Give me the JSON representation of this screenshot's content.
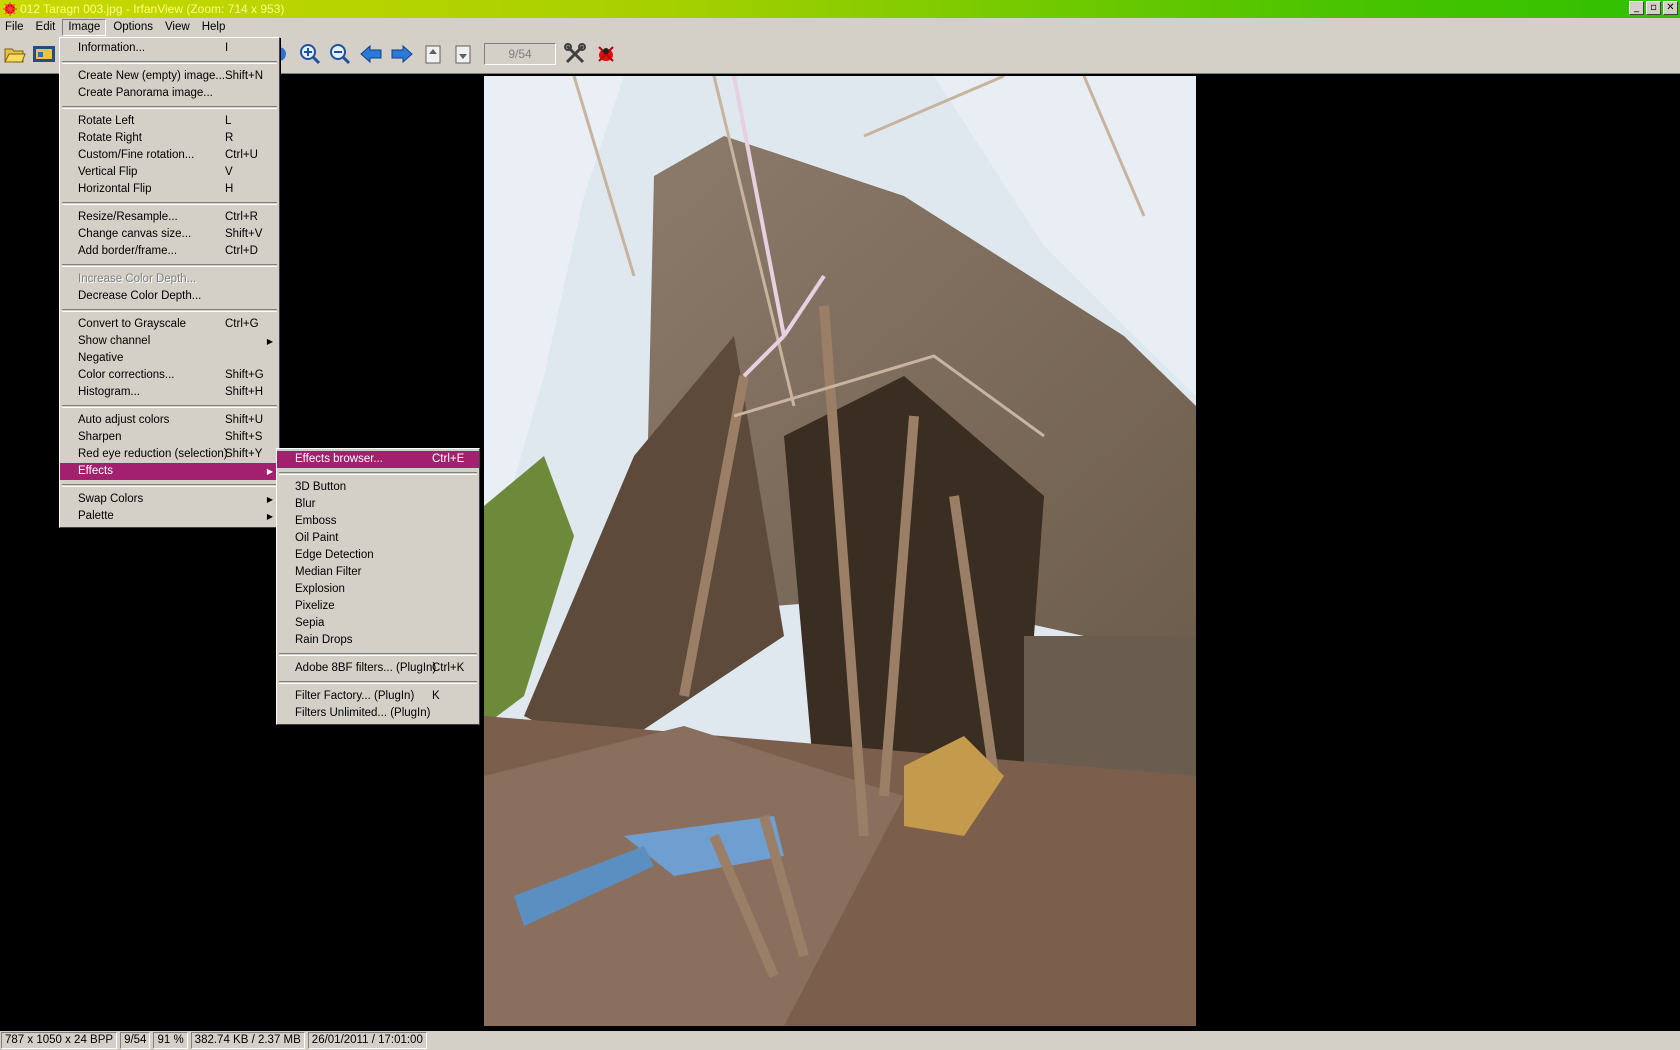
{
  "window": {
    "title": "012 Taragn 003.jpg - IrfanView (Zoom: 714 x 953)",
    "buttons": {
      "minimize": "_",
      "maximize": "▫",
      "close": "✕"
    }
  },
  "menubar": [
    {
      "label": "File"
    },
    {
      "label": "Edit"
    },
    {
      "label": "Image"
    },
    {
      "label": "Options"
    },
    {
      "label": "View"
    },
    {
      "label": "Help"
    }
  ],
  "toolbar": {
    "page_counter": "9/54"
  },
  "image_menu": {
    "groups": [
      [
        {
          "label": "Information...",
          "shortcut": "I"
        }
      ],
      [
        {
          "label": "Create New (empty) image...",
          "shortcut": "Shift+N"
        },
        {
          "label": "Create Panorama image...",
          "shortcut": ""
        }
      ],
      [
        {
          "label": "Rotate Left",
          "shortcut": "L"
        },
        {
          "label": "Rotate Right",
          "shortcut": "R"
        },
        {
          "label": "Custom/Fine rotation...",
          "shortcut": "Ctrl+U"
        },
        {
          "label": "Vertical Flip",
          "shortcut": "V"
        },
        {
          "label": "Horizontal Flip",
          "shortcut": "H"
        }
      ],
      [
        {
          "label": "Resize/Resample...",
          "shortcut": "Ctrl+R"
        },
        {
          "label": "Change canvas size...",
          "shortcut": "Shift+V"
        },
        {
          "label": "Add border/frame...",
          "shortcut": "Ctrl+D"
        }
      ],
      [
        {
          "label": "Increase Color Depth...",
          "shortcut": "",
          "disabled": true
        },
        {
          "label": "Decrease Color Depth...",
          "shortcut": ""
        }
      ],
      [
        {
          "label": "Convert to Grayscale",
          "shortcut": "Ctrl+G"
        },
        {
          "label": "Show channel",
          "shortcut": "",
          "submenu": true
        },
        {
          "label": "Negative",
          "shortcut": ""
        },
        {
          "label": "Color corrections...",
          "shortcut": "Shift+G"
        },
        {
          "label": "Histogram...",
          "shortcut": "Shift+H"
        }
      ],
      [
        {
          "label": "Auto adjust colors",
          "shortcut": "Shift+U"
        },
        {
          "label": "Sharpen",
          "shortcut": "Shift+S"
        },
        {
          "label": "Red eye reduction (selection)",
          "shortcut": "Shift+Y"
        },
        {
          "label": "Effects",
          "shortcut": "",
          "submenu": true,
          "selected": true
        }
      ],
      [
        {
          "label": "Swap Colors",
          "shortcut": "",
          "submenu": true
        },
        {
          "label": "Palette",
          "shortcut": "",
          "submenu": true
        }
      ]
    ]
  },
  "effects_submenu": {
    "groups": [
      [
        {
          "label": "Effects browser...",
          "shortcut": "Ctrl+E",
          "selected": true
        }
      ],
      [
        {
          "label": "3D Button",
          "shortcut": ""
        },
        {
          "label": "Blur",
          "shortcut": ""
        },
        {
          "label": "Emboss",
          "shortcut": ""
        },
        {
          "label": "Oil Paint",
          "shortcut": ""
        },
        {
          "label": "Edge Detection",
          "shortcut": ""
        },
        {
          "label": "Median Filter",
          "shortcut": ""
        },
        {
          "label": "Explosion",
          "shortcut": ""
        },
        {
          "label": "Pixelize",
          "shortcut": ""
        },
        {
          "label": "Sepia",
          "shortcut": ""
        },
        {
          "label": "Rain Drops",
          "shortcut": ""
        }
      ],
      [
        {
          "label": "Adobe 8BF filters... (PlugIn)",
          "shortcut": "Ctrl+K"
        }
      ],
      [
        {
          "label": "Filter Factory... (PlugIn)",
          "shortcut": "K"
        },
        {
          "label": "Filters Unlimited... (PlugIn)",
          "shortcut": ""
        }
      ]
    ]
  },
  "statusbar": [
    "787 x 1050 x 24 BPP",
    "9/54",
    "91 %",
    "382.74 KB / 2.37 MB",
    "26/01/2011 / 17:01:00"
  ],
  "colors": {
    "menu_highlight": "#a3206e",
    "menu_bg": "#d4d0c8",
    "canvas_bg": "#000000"
  }
}
